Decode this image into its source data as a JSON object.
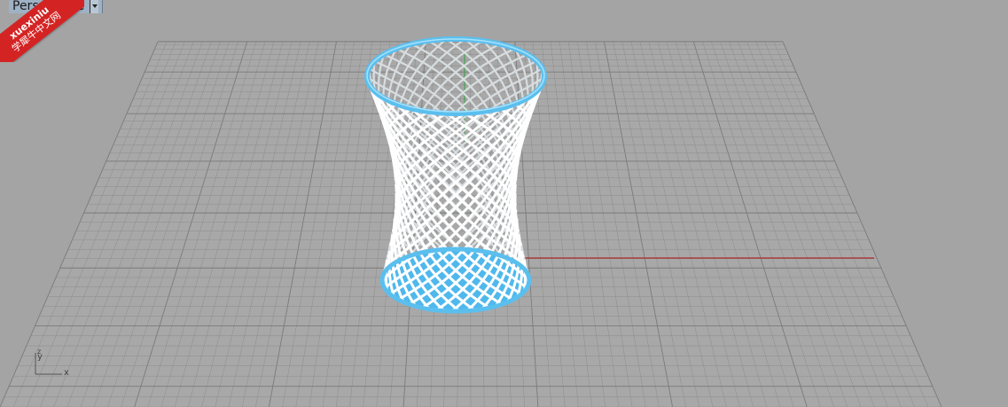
{
  "viewport": {
    "title": "Perspective",
    "background_color": "#a4a4a4",
    "grid_line_color": "#8c8c8c",
    "grid_major_color": "#7a7a7a",
    "grid_fill_color": "#a8a8a8",
    "x_axis_color": "#b02a2a",
    "y_axis_color": "#2fa03a"
  },
  "model": {
    "name": "mesh-basket",
    "mesh_color": "#ffffff",
    "rim_color": "#5bbfee",
    "base_color": "#4fb8ec"
  },
  "axis_widget": {
    "x_label": "x",
    "y_label": "y",
    "z_label": "z"
  },
  "watermark": {
    "top_text": "xuexiniu",
    "bottom_text": "学犀牛中文网",
    "color": "#d42323"
  }
}
